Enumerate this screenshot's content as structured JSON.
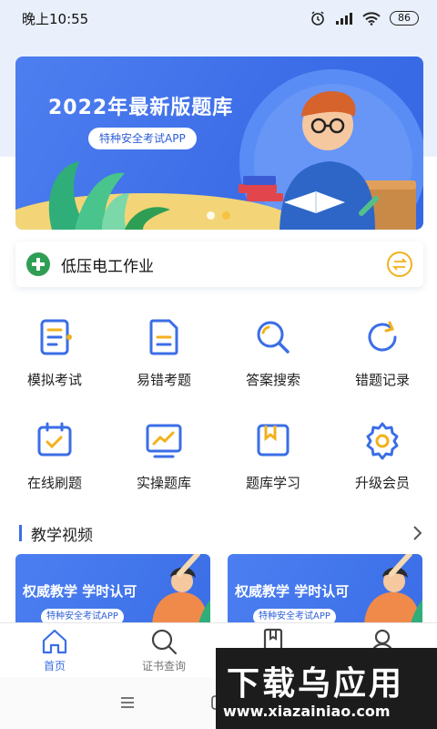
{
  "status_bar": {
    "time": "晚上10:55",
    "battery": "86"
  },
  "banner": {
    "title": "2022年最新版题库",
    "subtitle": "特种安全考试APP"
  },
  "category": {
    "label": "低压电工作业"
  },
  "grid": [
    {
      "label": "模拟考试",
      "icon": "mock-exam-icon"
    },
    {
      "label": "易错考题",
      "icon": "error-prone-icon"
    },
    {
      "label": "答案搜索",
      "icon": "search-icon"
    },
    {
      "label": "错题记录",
      "icon": "refresh-record-icon"
    },
    {
      "label": "在线刷题",
      "icon": "calendar-check-icon"
    },
    {
      "label": "实操题库",
      "icon": "chart-screen-icon"
    },
    {
      "label": "题库学习",
      "icon": "bookmark-box-icon"
    },
    {
      "label": "升级会员",
      "icon": "gear-icon"
    }
  ],
  "section": {
    "title": "教学视频"
  },
  "videos": [
    {
      "title": "权威教学 学时认可",
      "tag": "特种安全考试APP"
    },
    {
      "title": "权威教学 学时认可",
      "tag": "特种安全考试APP"
    }
  ],
  "bottom_nav": [
    {
      "label": "首页",
      "icon": "home-icon",
      "active": true
    },
    {
      "label": "证书查询",
      "icon": "search-icon",
      "active": false
    },
    {
      "label": "",
      "icon": "book-icon",
      "active": false
    },
    {
      "label": "",
      "icon": "user-icon",
      "active": false
    }
  ],
  "watermark": {
    "main": "下载乌应用",
    "url": "www.xiazainiao.com"
  },
  "colors": {
    "accent": "#3b6ee6",
    "yellow": "#f2b11c",
    "green": "#2f9e55"
  }
}
